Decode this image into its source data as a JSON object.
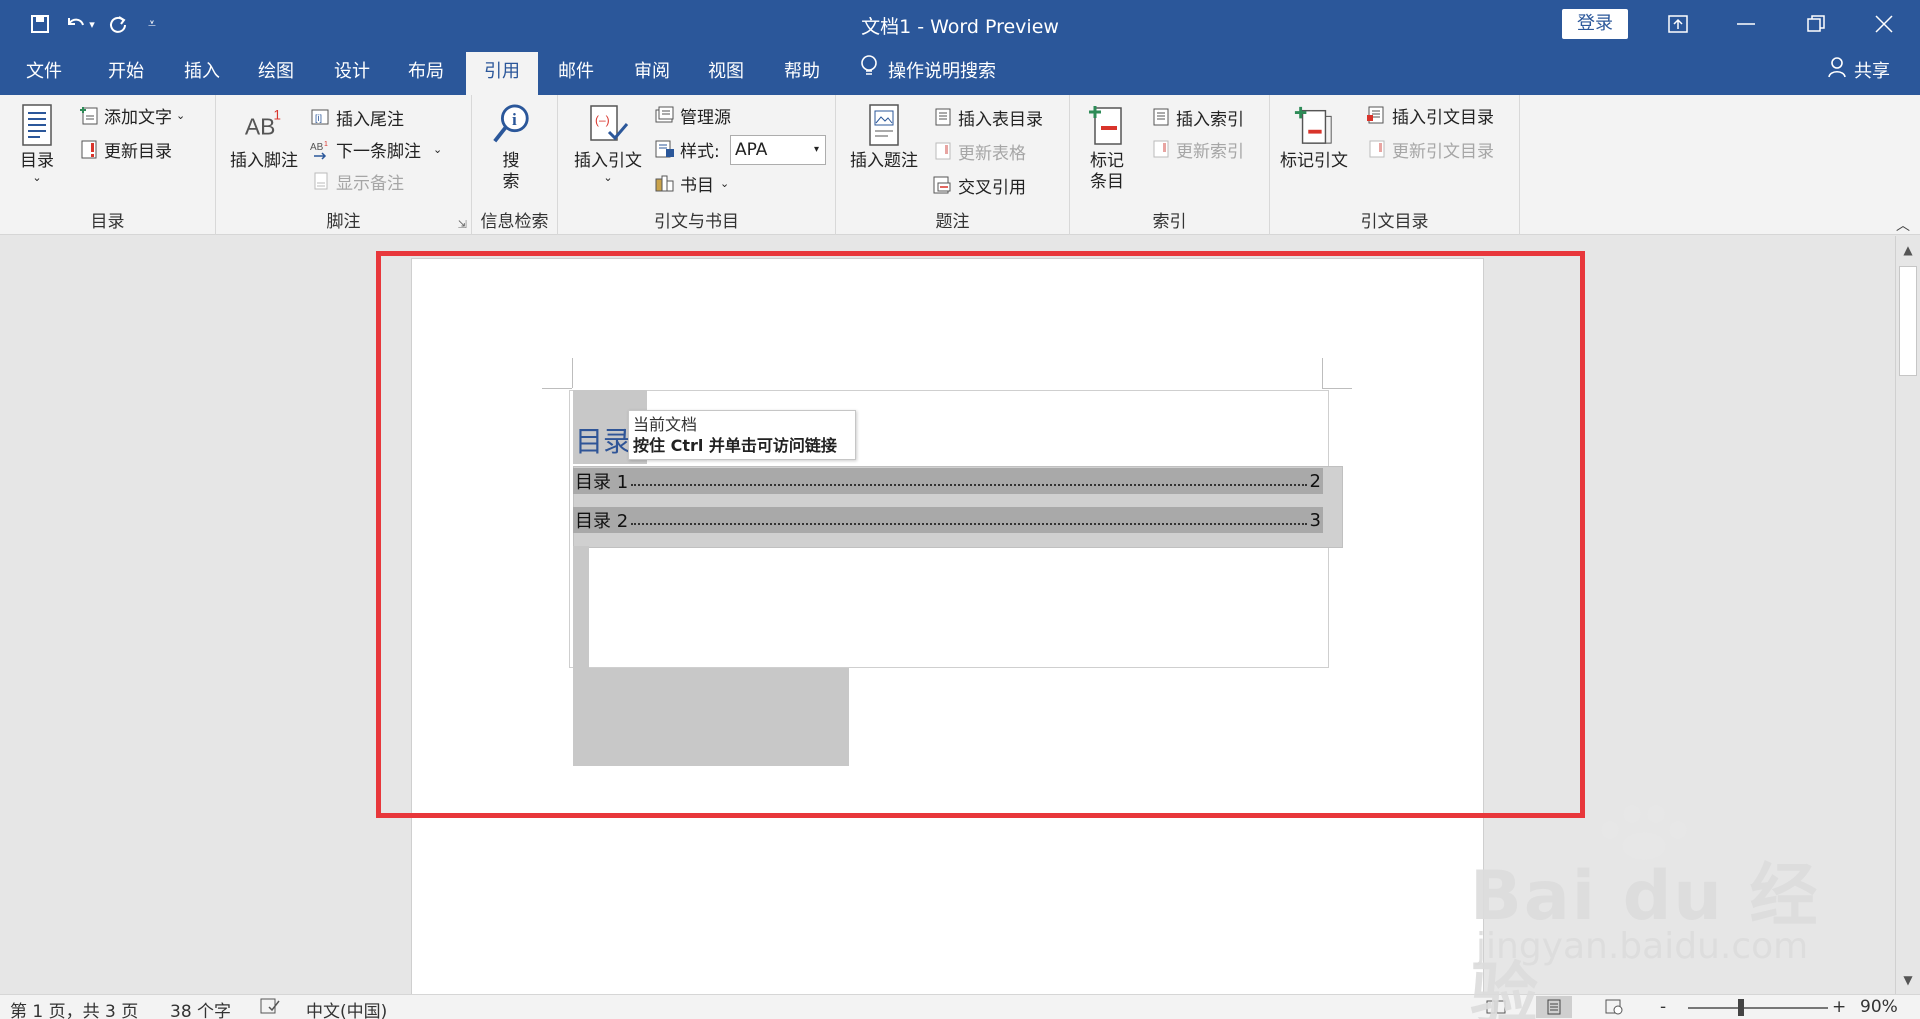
{
  "titlebar": {
    "title": "文档1 - Word Preview",
    "login_label": "登录"
  },
  "quick_access": {
    "save_icon": "save-icon",
    "undo_icon": "undo-icon",
    "redo_icon": "redo-icon",
    "customize_icon": "customize-icon"
  },
  "tabs": [
    {
      "label": "文件"
    },
    {
      "label": "开始"
    },
    {
      "label": "插入"
    },
    {
      "label": "绘图"
    },
    {
      "label": "设计"
    },
    {
      "label": "布局"
    },
    {
      "label": "引用",
      "active": true
    },
    {
      "label": "邮件"
    },
    {
      "label": "审阅"
    },
    {
      "label": "视图"
    },
    {
      "label": "帮助"
    }
  ],
  "tellme": "操作说明搜索",
  "share": "共享",
  "ribbon": {
    "toc": {
      "group_label": "目录",
      "toc_btn": "目录",
      "add_text": "添加文字",
      "update_toc": "更新目录"
    },
    "footnotes": {
      "group_label": "脚注",
      "insert_footnote": "插入脚注",
      "insert_endnote": "插入尾注",
      "next_footnote": "下一条脚注",
      "show_notes": "显示备注"
    },
    "research": {
      "group_label": "信息检索",
      "search_top": "搜",
      "search_bottom": "索"
    },
    "citations": {
      "group_label": "引文与书目",
      "insert_citation": "插入引文",
      "manage_sources": "管理源",
      "style_label": "样式:",
      "style_value": "APA",
      "bibliography": "书目"
    },
    "captions": {
      "group_label": "题注",
      "insert_caption": "插入题注",
      "insert_table_figures": "插入表目录",
      "update_table": "更新表格",
      "cross_reference": "交叉引用"
    },
    "index": {
      "group_label": "索引",
      "mark_entry_top": "标记",
      "mark_entry_bottom": "条目",
      "insert_index": "插入索引",
      "update_index": "更新索引"
    },
    "authorities": {
      "group_label": "引文目录",
      "mark_citation": "标记引文",
      "insert_table_authorities": "插入引文目录",
      "update_table_authorities": "更新引文目录"
    }
  },
  "document": {
    "toc_title": "目录",
    "tooltip_line1": "当前文档",
    "tooltip_line2": "按住 Ctrl 并单击可访问链接",
    "toc_entries": [
      {
        "label": "目录 1",
        "page": "2"
      },
      {
        "label": "目录 2",
        "page": "3"
      }
    ]
  },
  "statusbar": {
    "page_info": "第 1 页，共 3 页",
    "word_count": "38 个字",
    "language": "中文(中国)",
    "zoom": "90%",
    "zoom_minus": "-",
    "zoom_plus": "+"
  },
  "watermark": {
    "brand": "Bai du 经验",
    "url": "jingyan.baidu.com"
  },
  "colors": {
    "title_blue": "#2b579a",
    "highlight_red": "#e8373b"
  }
}
